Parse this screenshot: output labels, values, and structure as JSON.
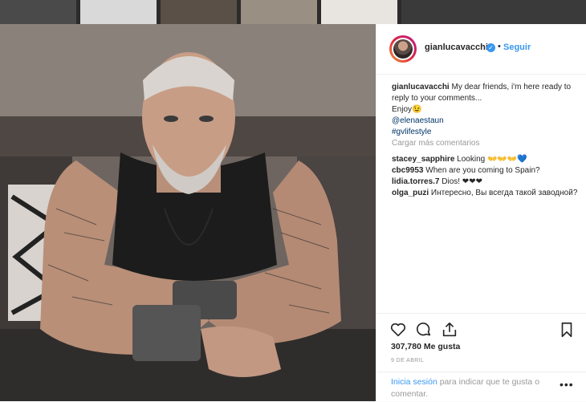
{
  "post": {
    "username": "gianlucavacchi",
    "follow_label": "Seguir",
    "separator": "•",
    "verified_glyph": "✓"
  },
  "caption": {
    "username": "gianlucavacchi",
    "text": "My dear friends, i'm here ready to reply to your comments...",
    "line2": "Enjoy😉",
    "mention": "@elenaestaun",
    "hashtag": "#gvlifestyle"
  },
  "load_more_label": "Cargar más comentarios",
  "comments": [
    {
      "user": "stacey_sapphire",
      "text": "Looking 👐👐👐💙"
    },
    {
      "user": "cbc9953",
      "text": "When are you coming to Spain?"
    },
    {
      "user": "lidia.torres.7",
      "text": "Dios! ❤❤❤"
    },
    {
      "user": "olga_puzi",
      "text": "Интересно, Вы всегда такой заводной?"
    }
  ],
  "stats": {
    "likes": "307,780 Me gusta",
    "date": "9 DE ABRIL"
  },
  "login": {
    "link": "Inicia sesión",
    "text": " para indicar que te gusta o comentar."
  },
  "more_glyph": "•••",
  "icons": [
    "heart-icon",
    "comment-icon",
    "share-icon",
    "bookmark-icon",
    "verified-icon",
    "more-options-icon"
  ],
  "colors": {
    "link": "#3897f0",
    "text": "#262626",
    "muted": "#999999",
    "mention": "#003569"
  }
}
